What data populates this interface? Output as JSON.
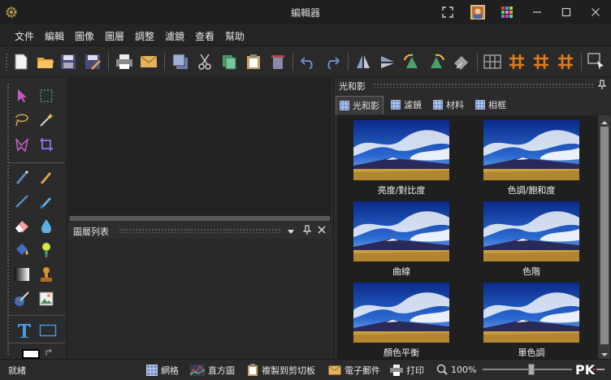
{
  "window": {
    "title": "編輯器"
  },
  "menu": [
    "文件",
    "編輯",
    "圖像",
    "圖層",
    "調整",
    "濾鏡",
    "查看",
    "幫助"
  ],
  "layers_panel": {
    "title": "圖層列表"
  },
  "effects_panel": {
    "title": "光和影",
    "tabs": [
      "光和影",
      "濾鏡",
      "材料",
      "相框"
    ],
    "active_tab": 0,
    "items": [
      "亮度/對比度",
      "色調/飽和度",
      "曲線",
      "色階",
      "顏色平衡",
      "單色調"
    ]
  },
  "statusbar": {
    "status": "就緒",
    "grid": "網格",
    "histogram": "直方圖",
    "copy_clipboard": "複製到剪切板",
    "email": "電子郵件",
    "print": "打印",
    "zoom": "100%",
    "zoom_level": 0.55
  },
  "colors": {
    "accent": "#e07a1a",
    "background": "#2b2b2b",
    "panel": "#1f1f1f"
  }
}
